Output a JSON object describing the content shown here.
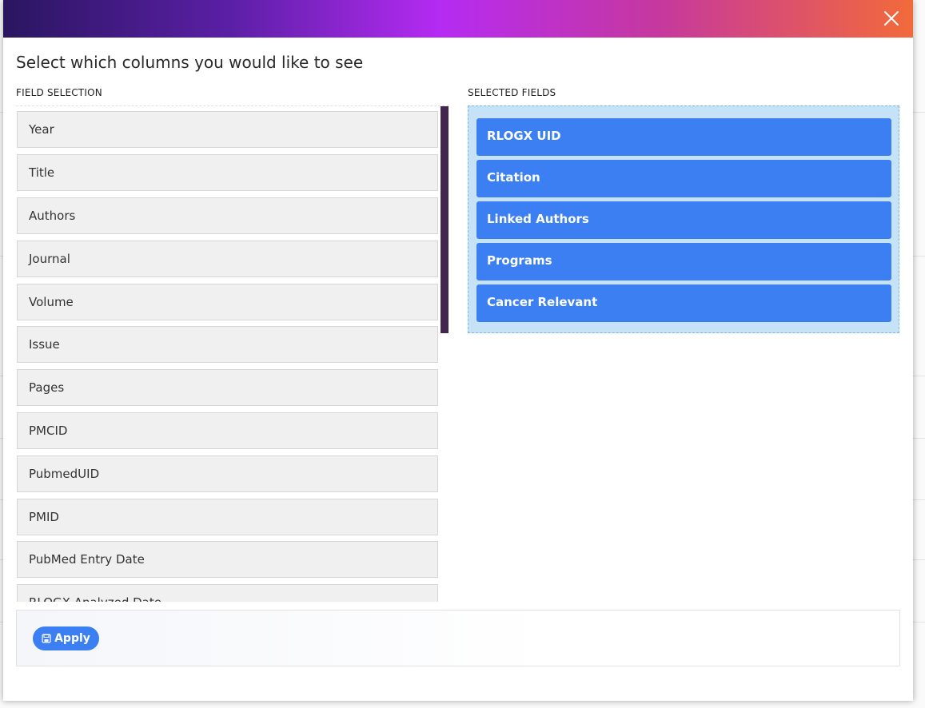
{
  "modal": {
    "title": "Select which columns you would like to see",
    "close_icon": "close-icon"
  },
  "field_selection": {
    "label": "FIELD SELECTION",
    "items": [
      "Year",
      "Title",
      "Authors",
      "Journal",
      "Volume",
      "Issue",
      "Pages",
      "PMCID",
      "PubmedUID",
      "PMID",
      "PubMed Entry Date",
      "RLOGX Analyzed Date"
    ]
  },
  "selected_fields": {
    "label": "SELECTED FIELDS",
    "items": [
      "RLOGX UID",
      "Citation",
      "Linked Authors",
      "Programs",
      "Cancer Relevant"
    ]
  },
  "footer": {
    "apply_label": "Apply",
    "apply_icon": "save-icon"
  },
  "colors": {
    "accent": "#3b7ff2",
    "selected_zone": "#c6e2f7",
    "field_bg": "#f0f0f0",
    "scrollbar": "#43264f"
  }
}
